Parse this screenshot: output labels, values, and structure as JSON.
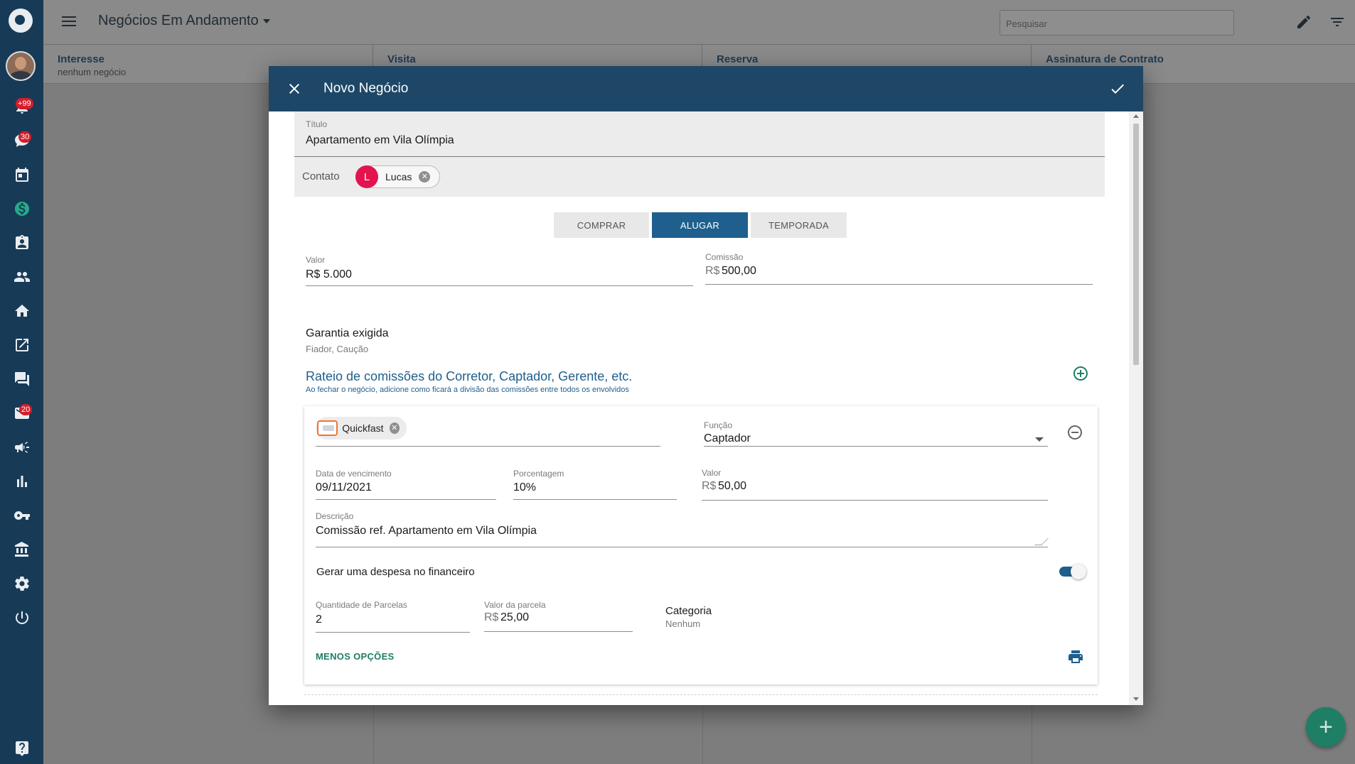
{
  "topbar": {
    "title": "Negócios Em Andamento",
    "search_placeholder": "Pesquisar"
  },
  "sidebar": {
    "badges": {
      "notifications": "+99",
      "chat": "30",
      "mail": "20"
    }
  },
  "stages": [
    {
      "name": "Interesse",
      "sub": "nenhum negócio"
    },
    {
      "name": "Visita",
      "sub": ""
    },
    {
      "name": "Reserva",
      "sub": ""
    },
    {
      "name": "Assinatura de Contrato",
      "sub": ""
    }
  ],
  "modal": {
    "title": "Novo Negócio",
    "titulo_label": "Título",
    "titulo_value": "Apartamento em Vila Olímpia",
    "contato_label": "Contato",
    "contato_chip": {
      "initial": "L",
      "name": "Lucas"
    },
    "segments": [
      "COMPRAR",
      "ALUGAR",
      "TEMPORADA"
    ],
    "active_segment": "ALUGAR",
    "valor_label": "Valor",
    "valor_value": "R$ 5.000",
    "comissao_label": "Comissão",
    "comissao_prefix": "R$",
    "comissao_value": "500,00",
    "garantia_title": "Garantia exigida",
    "garantia_value": "Fiador, Caução",
    "rateio_title": "Rateio de comissões do Corretor, Captador, Gerente, etc.",
    "rateio_sub": "Ao fechar o negócio, adicione como ficará a divisão das comissões entre todos os envolvidos",
    "split": {
      "person_chip": "Quickfast",
      "funcao_label": "Função",
      "funcao_value": "Captador",
      "vencimento_label": "Data de vencimento",
      "vencimento_value": "09/11/2021",
      "porcentagem_label": "Porcentagem",
      "porcentagem_value": "10%",
      "valor_label": "Valor",
      "valor_prefix": "R$",
      "valor_value": "50,00",
      "descricao_label": "Descrição",
      "descricao_value": "Comissão ref. Apartamento em Vila Olímpia",
      "despesa_label": "Gerar uma despesa no financeiro",
      "despesa_enabled": true,
      "parcelas_label": "Quantidade de Parcelas",
      "parcelas_value": "2",
      "valor_parcela_label": "Valor da parcela",
      "valor_parcela_prefix": "R$",
      "valor_parcela_value": "25,00",
      "categoria_label": "Categoria",
      "categoria_value": "Nenhum",
      "menos_opcoes": "MENOS OPÇÕES"
    }
  },
  "colors": {
    "sidebar": "#173a57",
    "header": "#1e4767",
    "primary": "#1e5f8e",
    "accent": "#1e7e66",
    "badge": "#d41e2a"
  },
  "icons": [
    "menu-icon",
    "close-icon",
    "check-icon",
    "pencil-icon",
    "filter-icon",
    "add-circle-icon",
    "remove-circle-icon",
    "printer-icon",
    "plus-icon"
  ]
}
